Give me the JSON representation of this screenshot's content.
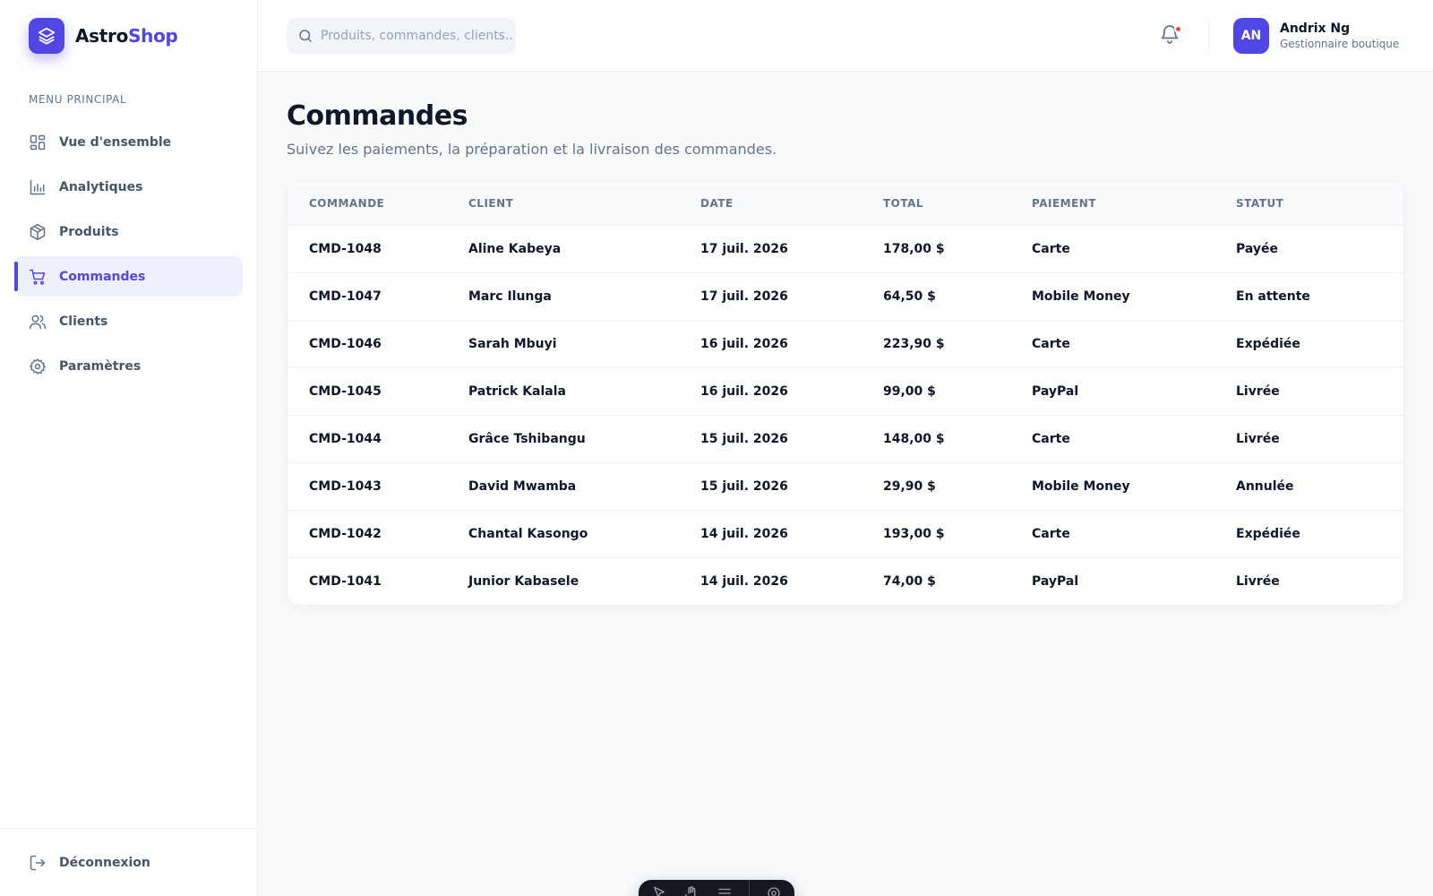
{
  "brand": {
    "part1": "Astro",
    "part2": "Shop",
    "icon": "layers-icon"
  },
  "sidebar": {
    "section_label": "MENU PRINCIPAL",
    "items": [
      {
        "label": "Vue d'ensemble",
        "icon": "dashboard-icon"
      },
      {
        "label": "Analytiques",
        "icon": "chart-icon"
      },
      {
        "label": "Produits",
        "icon": "box-icon"
      },
      {
        "label": "Commandes",
        "icon": "cart-icon",
        "active": true
      },
      {
        "label": "Clients",
        "icon": "users-icon"
      },
      {
        "label": "Paramètres",
        "icon": "gear-icon"
      }
    ],
    "logout_label": "Déconnexion"
  },
  "header": {
    "search": {
      "placeholder": "Produits, commandes, clients...",
      "value": ""
    },
    "notifications": {
      "has_unread": true,
      "icon": "bell-icon"
    },
    "user": {
      "initials": "AN",
      "name": "Andrix Ng",
      "role": "Gestionnaire boutique"
    }
  },
  "page": {
    "title": "Commandes",
    "subtitle": "Suivez les paiements, la préparation et la livraison des commandes."
  },
  "orders": {
    "columns": [
      "COMMANDE",
      "CLIENT",
      "DATE",
      "TOTAL",
      "PAIEMENT",
      "STATUT"
    ],
    "rows": [
      {
        "id": "CMD-1048",
        "client": "Aline Kabeya",
        "date": "17 juil. 2026",
        "total": "178,00 $",
        "payment": "Carte",
        "status": "Payée"
      },
      {
        "id": "CMD-1047",
        "client": "Marc Ilunga",
        "date": "17 juil. 2026",
        "total": "64,50 $",
        "payment": "Mobile Money",
        "status": "En attente"
      },
      {
        "id": "CMD-1046",
        "client": "Sarah Mbuyi",
        "date": "16 juil. 2026",
        "total": "223,90 $",
        "payment": "Carte",
        "status": "Expédiée"
      },
      {
        "id": "CMD-1045",
        "client": "Patrick Kalala",
        "date": "16 juil. 2026",
        "total": "99,00 $",
        "payment": "PayPal",
        "status": "Livrée"
      },
      {
        "id": "CMD-1044",
        "client": "Grâce Tshibangu",
        "date": "15 juil. 2026",
        "total": "148,00 $",
        "payment": "Carte",
        "status": "Livrée"
      },
      {
        "id": "CMD-1043",
        "client": "David Mwamba",
        "date": "15 juil. 2026",
        "total": "29,90 $",
        "payment": "Mobile Money",
        "status": "Annulée"
      },
      {
        "id": "CMD-1042",
        "client": "Chantal Kasongo",
        "date": "14 juil. 2026",
        "total": "193,00 $",
        "payment": "Carte",
        "status": "Expédiée"
      },
      {
        "id": "CMD-1041",
        "client": "Junior Kabasele",
        "date": "14 juil. 2026",
        "total": "74,00 $",
        "payment": "PayPal",
        "status": "Livrée"
      }
    ]
  },
  "colors": {
    "accent": "#4f46e5",
    "accent_soft": "#eef0fe",
    "text": "#0f172a",
    "muted": "#64748b",
    "background": "#f8fafc",
    "notification_dot": "#ef4444",
    "dock": "#151821"
  },
  "dock": {
    "icons": [
      "pointer-icon",
      "hand-icon",
      "menu-icon",
      "gear-icon"
    ]
  }
}
